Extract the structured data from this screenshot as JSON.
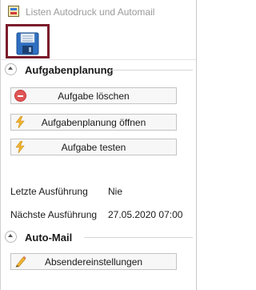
{
  "window": {
    "title": "Listen Autodruck und Automail"
  },
  "toolbar": {
    "save_icon": "floppy-disk-icon"
  },
  "sections": {
    "task_planning": {
      "title": "Aufgabenplanung",
      "buttons": {
        "delete": {
          "label": "Aufgabe löschen",
          "icon": "delete-circle-icon"
        },
        "open": {
          "label": "Aufgabenplanung öffnen",
          "icon": "lightning-icon"
        },
        "test": {
          "label": "Aufgabe testen",
          "icon": "lightning-icon"
        }
      }
    },
    "info": {
      "last_run_label": "Letzte Ausführung",
      "last_run_value": "Nie",
      "next_run_label": "Nächste Ausführung",
      "next_run_value": "27.05.2020 07:00"
    },
    "auto_mail": {
      "title": "Auto-Mail",
      "buttons": {
        "sender_settings": {
          "label": "Absendereinstellungen",
          "icon": "pencil-icon"
        }
      }
    }
  },
  "colors": {
    "save_highlight": "#7b1c2b",
    "lightning": "#f2b632",
    "delete": "#e05555",
    "title_text": "#9a9a9a"
  }
}
